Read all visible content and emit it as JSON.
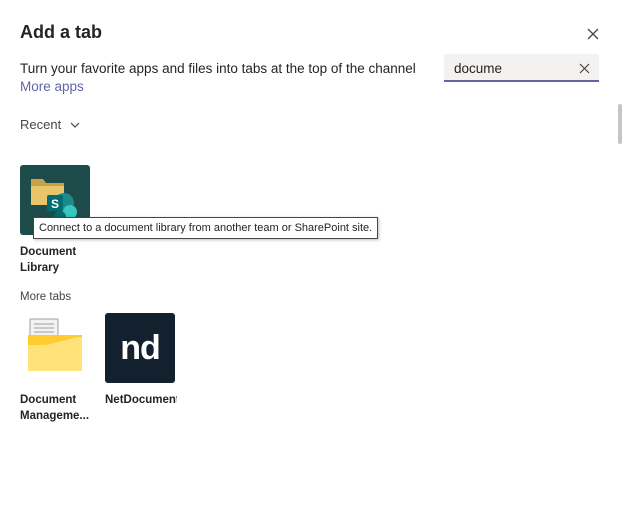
{
  "dialog": {
    "title": "Add a tab",
    "subtitle": "Turn your favorite apps and files into tabs at the top of the channel",
    "more_apps_link": "More apps",
    "close_icon": "close-icon"
  },
  "search": {
    "value": "docume",
    "placeholder": "",
    "clear_icon": "close-icon"
  },
  "recent": {
    "label": "Recent",
    "icon": "chevron-down-icon",
    "apps": [
      {
        "name": "Document\nLibrary",
        "icon": "sharepoint-document-library-icon",
        "tooltip": "Connect to a document library from another team or SharePoint site."
      }
    ]
  },
  "more_tabs": {
    "label": "More tabs",
    "apps": [
      {
        "name": "Document\nManageme...",
        "icon": "folder-document-icon"
      },
      {
        "name": "NetDocuments",
        "icon": "netdocuments-logo-icon"
      }
    ]
  },
  "colors": {
    "accent": "#6264a7",
    "text": "#252423",
    "search_bg": "#f3f2f1",
    "doclib_bg": "#1e4c4a",
    "netdoc_bg": "#12212d",
    "folder_yellow": "#ffd335"
  },
  "logos": {
    "sharepoint_letter": "S",
    "netdocuments_mark": "nd"
  }
}
